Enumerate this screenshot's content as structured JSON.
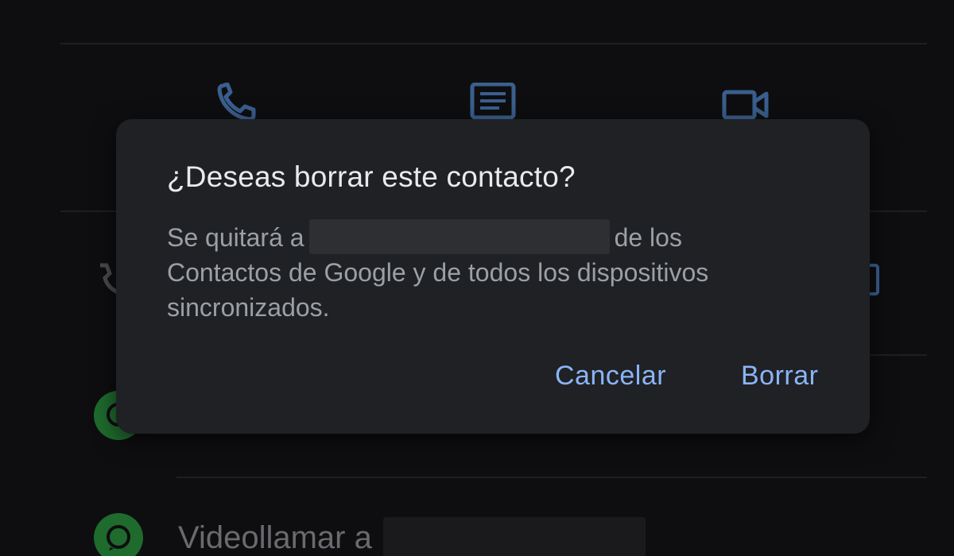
{
  "dialog": {
    "title": "¿Deseas borrar este contacto?",
    "body_prefix": "Se quitará a",
    "body_suffix": "de los",
    "body_line2": "Contactos de Google y de todos los dispositivos",
    "body_line3": "sincronizados.",
    "cancel_label": "Cancelar",
    "delete_label": "Borrar"
  },
  "background": {
    "actions": [
      {
        "icon": "phone-icon"
      },
      {
        "icon": "message-icon"
      },
      {
        "icon": "video-icon"
      }
    ],
    "whatsapp_row_label": "Videollamar a"
  },
  "colors": {
    "accent": "#8ab4f8",
    "dialog_bg": "#202124",
    "whatsapp_green": "#1f6b2e"
  }
}
